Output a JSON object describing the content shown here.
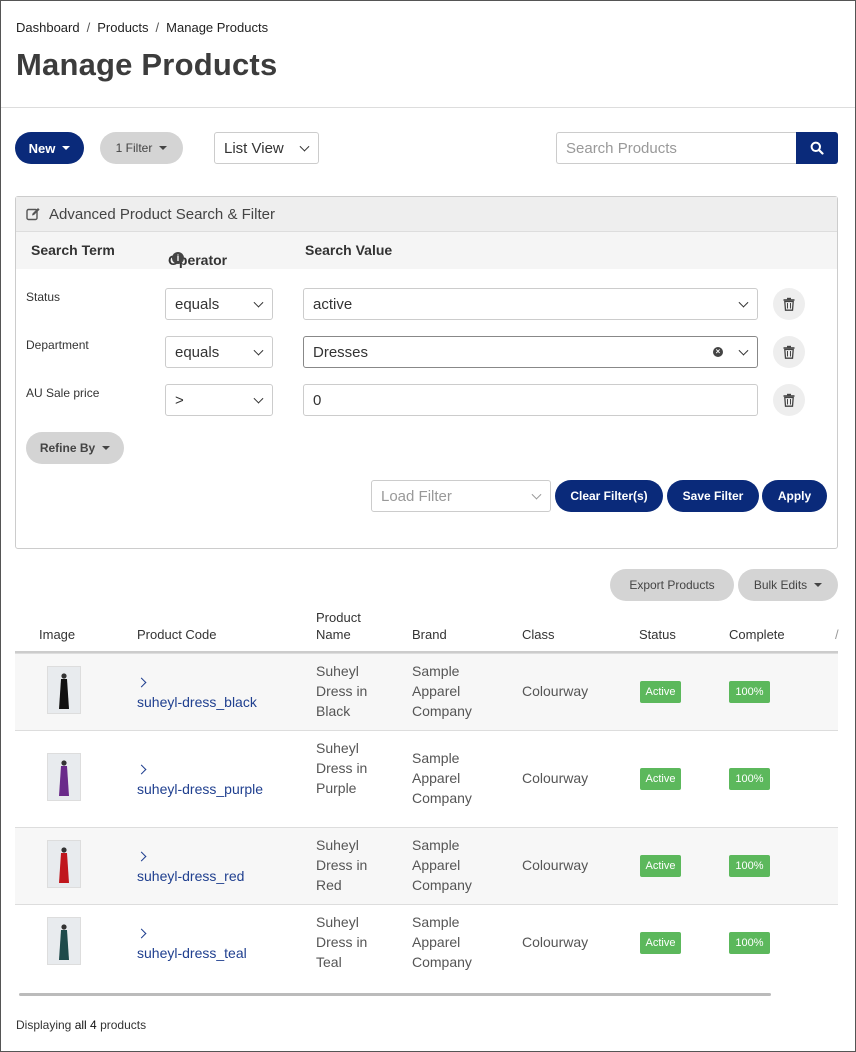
{
  "breadcrumb": [
    "Dashboard",
    "Products",
    "Manage Products"
  ],
  "page_title": "Manage Products",
  "toolbar": {
    "new_label": "New",
    "filter_label": "1 Filter",
    "view_label": "List View",
    "search_placeholder": "Search Products"
  },
  "advanced": {
    "title": "Advanced Product Search & Filter",
    "col_term": "Search Term",
    "col_operator": "Operator",
    "col_value": "Search Value",
    "filters": [
      {
        "term": "Status",
        "operator": "equals",
        "value": "active"
      },
      {
        "term": "Department",
        "operator": "equals",
        "value": "Dresses"
      },
      {
        "term": "AU Sale price",
        "operator": ">",
        "value": "0"
      }
    ],
    "refine_label": "Refine By",
    "load_placeholder": "Load Filter",
    "clear_label": "Clear Filter(s)",
    "save_label": "Save Filter",
    "apply_label": "Apply"
  },
  "actions": {
    "export_label": "Export Products",
    "bulk_label": "Bulk Edits"
  },
  "table": {
    "headers": {
      "image": "Image",
      "code": "Product Code",
      "name": "Product Name",
      "brand": "Brand",
      "class": "Class",
      "status": "Status",
      "complete": "Complete"
    },
    "rows": [
      {
        "code": "suheyl-dress_black",
        "name": "Suheyl Dress in Black",
        "brand": "Sample Apparel Company",
        "class": "Colourway",
        "status": "Active",
        "complete": "100%",
        "dress_color": "#111111"
      },
      {
        "code": "suheyl-dress_purple",
        "name": "Suheyl Dress in Purple",
        "brand": "Sample Apparel Company",
        "class": "Colourway",
        "status": "Active",
        "complete": "100%",
        "dress_color": "#6a2a8a"
      },
      {
        "code": "suheyl-dress_red",
        "name": "Suheyl Dress in Red",
        "brand": "Sample Apparel Company",
        "class": "Colourway",
        "status": "Active",
        "complete": "100%",
        "dress_color": "#c0161c"
      },
      {
        "code": "suheyl-dress_teal",
        "name": "Suheyl Dress in Teal",
        "brand": "Sample Apparel Company",
        "class": "Colourway",
        "status": "Active",
        "complete": "100%",
        "dress_color": "#1f4a4a"
      }
    ]
  },
  "footer": {
    "prefix": "Displaying",
    "all_n": "all 4",
    "suffix": "products"
  },
  "colors": {
    "primary": "#0a2a7a",
    "success": "#5cb85c",
    "link": "#1f3f8f"
  }
}
